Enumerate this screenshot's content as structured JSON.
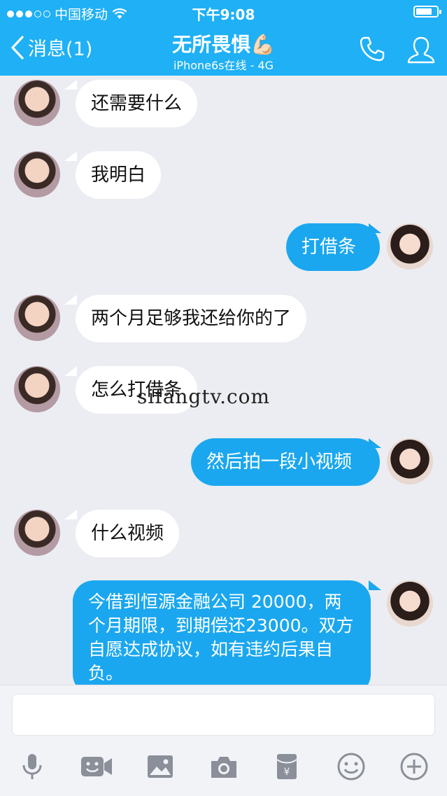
{
  "status": {
    "carrier": "中国移动",
    "time": "下午9:08"
  },
  "nav": {
    "back_label": "消息(1)",
    "title": "无所畏惧💪🏻",
    "subtitle": "iPhone6s在线 - 4G"
  },
  "messages": [
    {
      "side": "in",
      "text": "还需要什么"
    },
    {
      "side": "in",
      "text": "我明白"
    },
    {
      "side": "out",
      "text": "打借条"
    },
    {
      "side": "in",
      "text": "两个月足够我还给你的了"
    },
    {
      "side": "in",
      "text": "怎么打借条"
    },
    {
      "side": "out",
      "text": "然后拍一段小视频"
    },
    {
      "side": "in",
      "text": "什么视频"
    },
    {
      "side": "out",
      "text": "今借到恒源金融公司 20000，两个月期限，到期偿还23000。双方自愿达成协议，如有违约后果自负。"
    }
  ],
  "watermark": "sifangtv.com",
  "toolbar": {
    "icons": [
      "microphone-icon",
      "video-icon",
      "image-icon",
      "camera-icon",
      "red-packet-icon",
      "emoji-icon",
      "plus-icon"
    ]
  },
  "colors": {
    "brand": "#1fb0f5",
    "outgoing_bubble": "#1ba7ef",
    "incoming_bubble": "#ffffff",
    "background": "#ebedf2"
  }
}
